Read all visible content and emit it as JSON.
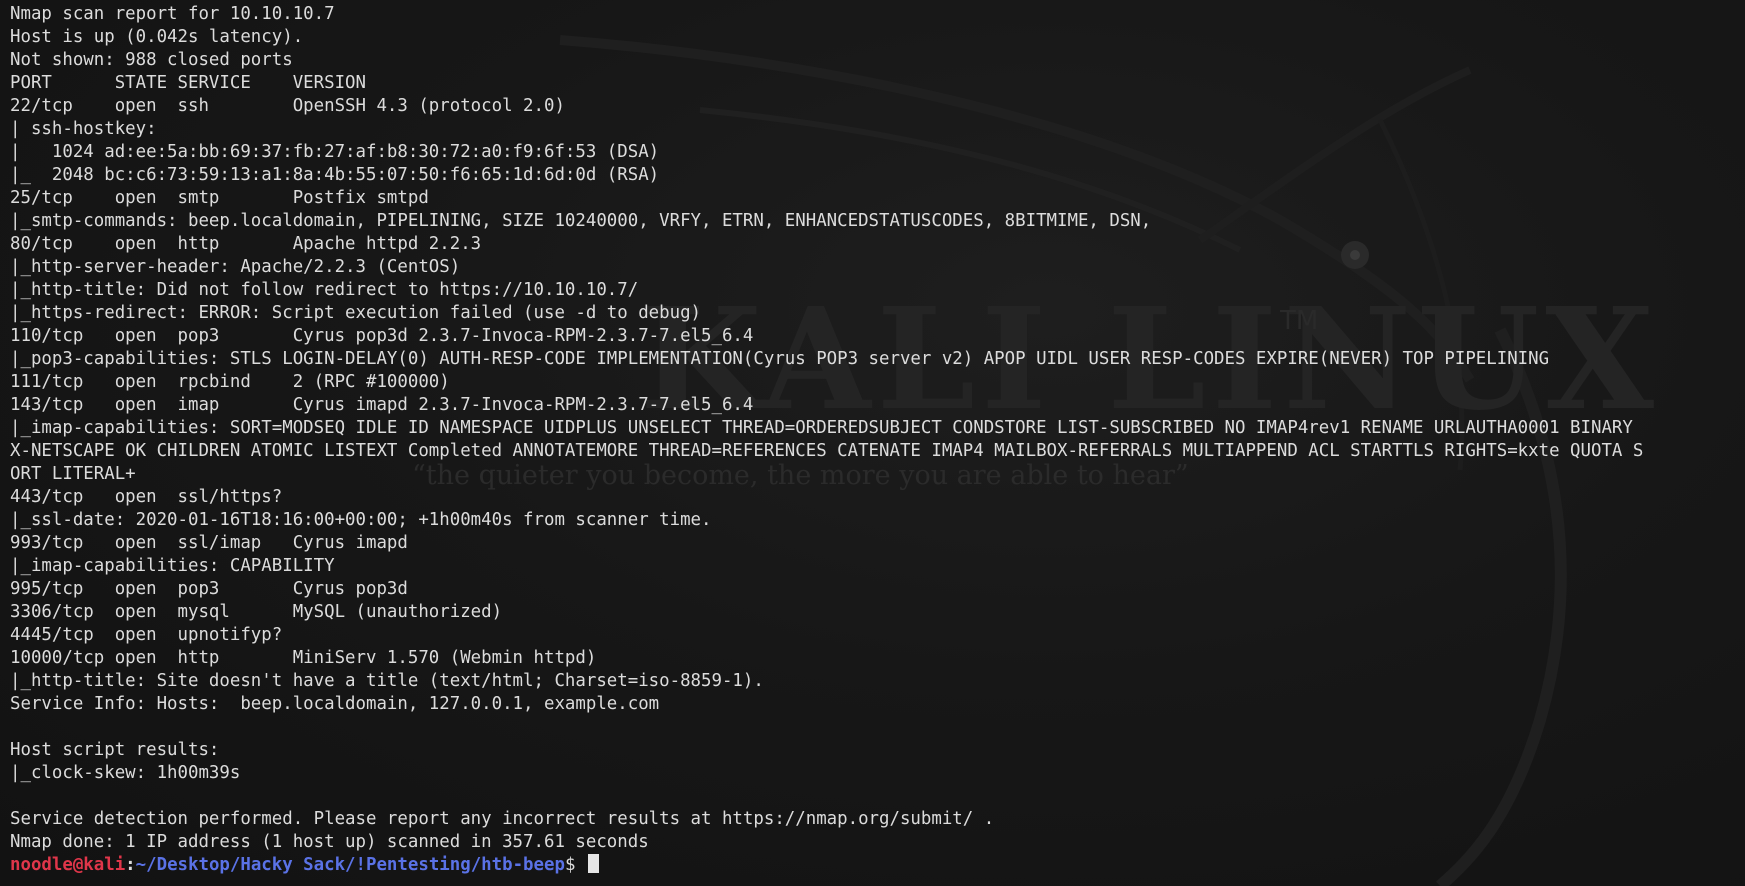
{
  "wallpaper": {
    "logo_text": "KALI LINUX",
    "trademark": "TM",
    "tagline": "“the quieter you become, the more you are able to hear”"
  },
  "output_lines": [
    "Nmap scan report for 10.10.10.7",
    "Host is up (0.042s latency).",
    "Not shown: 988 closed ports",
    "PORT      STATE SERVICE    VERSION",
    "22/tcp    open  ssh        OpenSSH 4.3 (protocol 2.0)",
    "| ssh-hostkey:",
    "|   1024 ad:ee:5a:bb:69:37:fb:27:af:b8:30:72:a0:f9:6f:53 (DSA)",
    "|_  2048 bc:c6:73:59:13:a1:8a:4b:55:07:50:f6:65:1d:6d:0d (RSA)",
    "25/tcp    open  smtp       Postfix smtpd",
    "|_smtp-commands: beep.localdomain, PIPELINING, SIZE 10240000, VRFY, ETRN, ENHANCEDSTATUSCODES, 8BITMIME, DSN,",
    "80/tcp    open  http       Apache httpd 2.2.3",
    "|_http-server-header: Apache/2.2.3 (CentOS)",
    "|_http-title: Did not follow redirect to https://10.10.10.7/",
    "|_https-redirect: ERROR: Script execution failed (use -d to debug)",
    "110/tcp   open  pop3       Cyrus pop3d 2.3.7-Invoca-RPM-2.3.7-7.el5_6.4",
    "|_pop3-capabilities: STLS LOGIN-DELAY(0) AUTH-RESP-CODE IMPLEMENTATION(Cyrus POP3 server v2) APOP UIDL USER RESP-CODES EXPIRE(NEVER) TOP PIPELINING",
    "111/tcp   open  rpcbind    2 (RPC #100000)",
    "143/tcp   open  imap       Cyrus imapd 2.3.7-Invoca-RPM-2.3.7-7.el5_6.4",
    "|_imap-capabilities: SORT=MODSEQ IDLE ID NAMESPACE UIDPLUS UNSELECT THREAD=ORDEREDSUBJECT CONDSTORE LIST-SUBSCRIBED NO IMAP4rev1 RENAME URLAUTHA0001 BINARY",
    "X-NETSCAPE OK CHILDREN ATOMIC LISTEXT Completed ANNOTATEMORE THREAD=REFERENCES CATENATE IMAP4 MAILBOX-REFERRALS MULTIAPPEND ACL STARTTLS RIGHTS=kxte QUOTA S",
    "ORT LITERAL+",
    "443/tcp   open  ssl/https?",
    "|_ssl-date: 2020-01-16T18:16:00+00:00; +1h00m40s from scanner time.",
    "993/tcp   open  ssl/imap   Cyrus imapd",
    "|_imap-capabilities: CAPABILITY",
    "995/tcp   open  pop3       Cyrus pop3d",
    "3306/tcp  open  mysql      MySQL (unauthorized)",
    "4445/tcp  open  upnotifyp?",
    "10000/tcp open  http       MiniServ 1.570 (Webmin httpd)",
    "|_http-title: Site doesn't have a title (text/html; Charset=iso-8859-1).",
    "Service Info: Hosts:  beep.localdomain, 127.0.0.1, example.com",
    "",
    "Host script results:",
    "|_clock-skew: 1h00m39s",
    "",
    "Service detection performed. Please report any incorrect results at https://nmap.org/submit/ .",
    "Nmap done: 1 IP address (1 host up) scanned in 357.61 seconds"
  ],
  "prompt": {
    "user_host": "noodle@kali",
    "separator": ":",
    "path": "~/Desktop/Hacky Sack/!Pentesting/htb-beep",
    "symbol": "$ "
  },
  "colors": {
    "background": "#141414",
    "text": "#dcdcdc",
    "prompt_user": "#e0364a",
    "prompt_path": "#5a72e6"
  }
}
